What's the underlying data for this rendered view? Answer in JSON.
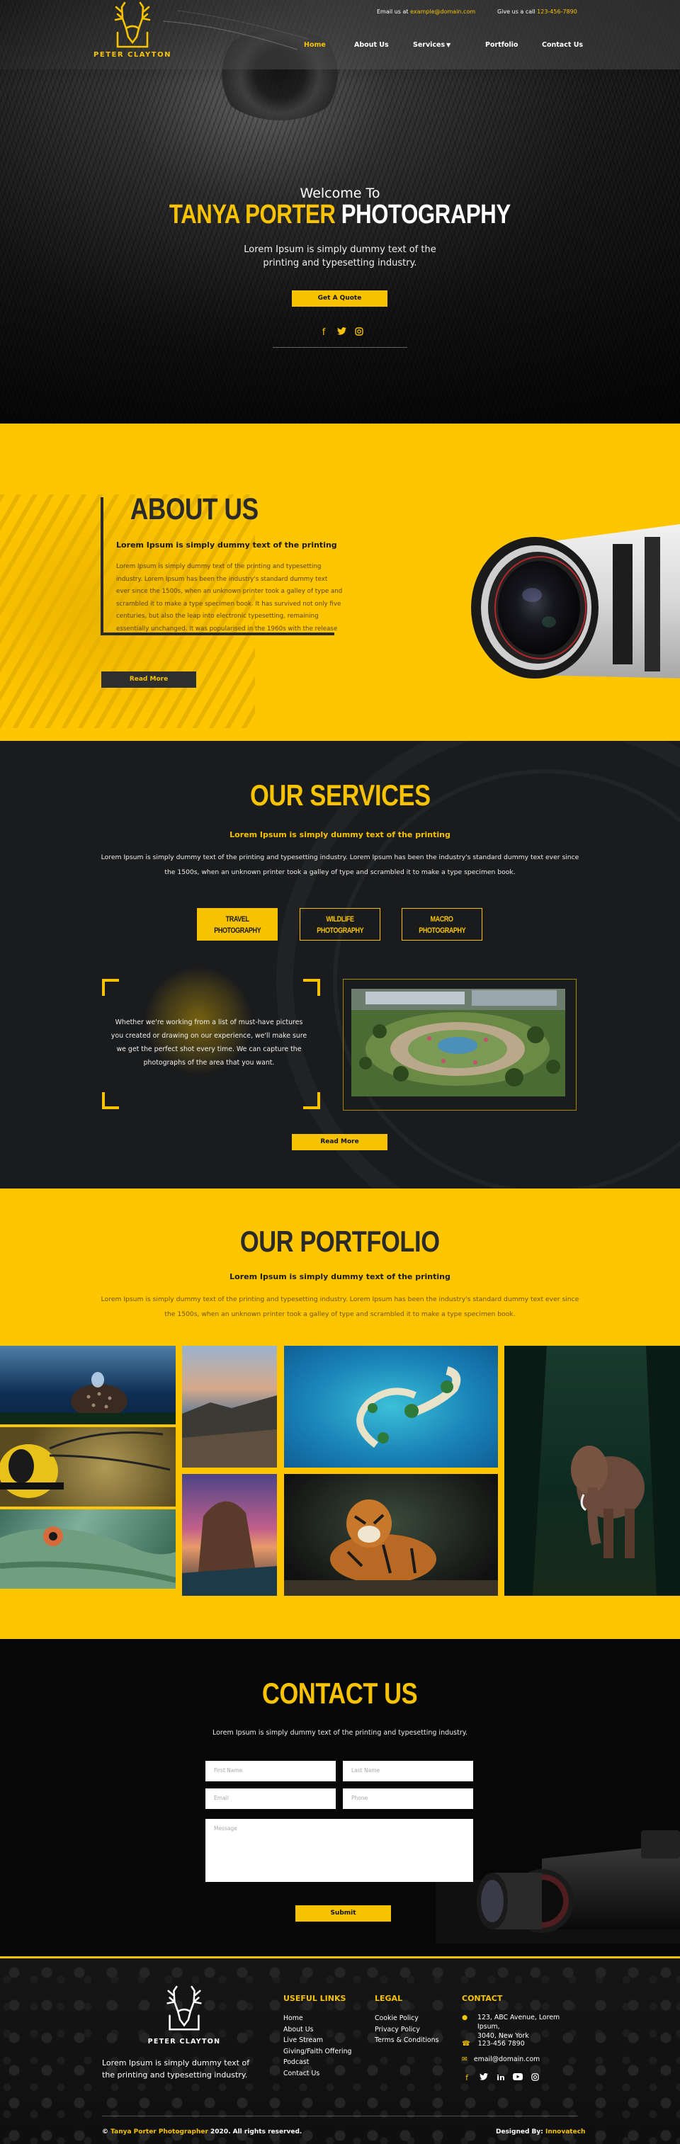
{
  "header": {
    "logo_text": "PETER CLAYTON",
    "email_label": "Email us at",
    "email": "example@domain.com",
    "phone_label": "Give us a call",
    "phone": "123-456-7890",
    "nav": [
      {
        "label": "Home",
        "active": true
      },
      {
        "label": "About Us"
      },
      {
        "label": "Services"
      },
      {
        "label": "Portfolio"
      },
      {
        "label": "Contact Us"
      }
    ]
  },
  "hero": {
    "welcome": "Welcome To",
    "title_accent": "TANYA PORTER",
    "title_rest": "PHOTOGRAPHY",
    "subtitle": "Lorem Ipsum is simply dummy text of the printing and typesetting industry.",
    "cta": "Get A Quote",
    "social_icons": [
      "facebook-icon",
      "twitter-icon",
      "instagram-icon"
    ]
  },
  "about": {
    "title": "ABOUT US",
    "subtitle": "Lorem Ipsum is simply dummy text of the printing",
    "body": "Lorem Ipsum is simply dummy text of the printing and typesetting industry. Lorem Ipsum has been the industry's standard dummy text ever since the 1500s, when an unknown printer took a galley of type and scrambled it to make a type specimen book. It has survived not only five centuries, but also the leap into electronic typesetting, remaining essentially unchanged. It was popularised in the 1960s with the release",
    "button": "Read More"
  },
  "services": {
    "title": "OUR SERVICES",
    "subtitle": "Lorem Ipsum is simply dummy text of the printing",
    "body": "Lorem Ipsum is simply dummy text of the printing and typesetting industry. Lorem Ipsum has been the industry's standard dummy text ever since the 1500s, when an unknown printer took a galley of type and scrambled it to make a type specimen book.",
    "tabs": [
      {
        "line1": "TRAVEL",
        "line2": "PHOTOGRAPHY",
        "active": true
      },
      {
        "line1": "WILDLIFE",
        "line2": "PHOTOGRAPHY"
      },
      {
        "line1": "MACRO",
        "line2": "PHOTOGRAPHY"
      }
    ],
    "panel_text": "Whether we're working from a list of must-have pictures you created or drawing on our experience, we'll make sure we get the perfect shot every time. We can capture the photographs of the area that you want.",
    "button": "Read More"
  },
  "portfolio": {
    "title": "OUR PORTFOLIO",
    "subtitle": "Lorem Ipsum is simply dummy text of the printing",
    "body": "Lorem Ipsum is simply dummy text of the printing and typesetting industry. Lorem Ipsum has been the industry's standard dummy text ever since the 1500s, when an unknown printer took a galley of type and scrambled it to make a type specimen book."
  },
  "contact": {
    "title": "CONTACT US",
    "subtitle": "Lorem Ipsum is simply dummy text of the printing and typesetting industry.",
    "placeholders": {
      "first_name": "First Name",
      "last_name": "Last Name",
      "email": "Email",
      "phone": "Phone",
      "message": "Message"
    },
    "submit": "Submit"
  },
  "footer": {
    "logo_text": "PETER CLAYTON",
    "tagline": "Lorem Ipsum is simply dummy text of the printing and typesetting industry.",
    "useful_links_title": "USEFUL LINKS",
    "useful_links": [
      "Home",
      "About Us",
      "Live Stream",
      "Giving/Faith Offering",
      "Podcast",
      "Contact Us"
    ],
    "legal_title": "LEGAL",
    "legal_links": [
      "Cookie Policy",
      "Privacy Policy",
      "Terms & Conditions"
    ],
    "contact_title": "CONTACT",
    "address_line1": "123, ABC Avenue, Lorem Ipsum,",
    "address_line2": "3040, New York",
    "phone": "123-456 7890",
    "email": "email@domain.com",
    "social_icons": [
      "facebook-icon",
      "twitter-icon",
      "linkedin-icon",
      "youtube-icon",
      "instagram-icon"
    ],
    "copyright_symbol": "©",
    "copyright_name": "Tanya Porter Photographer",
    "copyright_rest": "2020. All rights reserved.",
    "designed_label": "Designed By:",
    "designed_by": "Innovatech"
  },
  "colors": {
    "accent": "#f7c300",
    "section_yellow": "#fec501",
    "dark": "#1a1b1d"
  }
}
